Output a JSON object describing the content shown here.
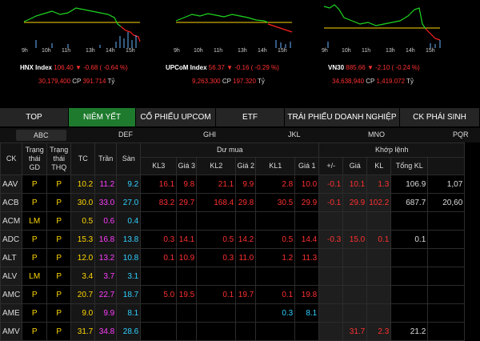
{
  "indices": [
    {
      "name": "HNX Index",
      "value": "106.40",
      "change": "▼ -0.68 ( -0.64 %)",
      "volume": "30,179,400",
      "cp_label": "CP",
      "amount": "391.714",
      "unit": "Tỷ"
    },
    {
      "name": "UPCoM Index",
      "value": "56.37",
      "change": "▼ -0.16 ( -0.29 %)",
      "volume": "9,263,300",
      "cp_label": "CP",
      "amount": "197.320",
      "unit": "Tỷ"
    },
    {
      "name": "VN30",
      "value": "885.66",
      "change": "▼ -2.10 ( -0.24 %)",
      "volume": "34,638,940",
      "cp_label": "CP",
      "amount": "1,419.072",
      "unit": "Tỷ"
    }
  ],
  "chart_ticks": [
    "9h",
    "10h",
    "11h",
    "13h",
    "14h",
    "15h"
  ],
  "tabs": [
    "TOP",
    "NIÊM YẾT",
    "CỔ PHIẾU UPCOM",
    "ETF",
    "TRÁI PHIẾU DOANH NGHIỆP",
    "CK PHÁI SINH"
  ],
  "letters": [
    "ABC",
    "DEF",
    "GHI",
    "JKL",
    "MNO",
    "PQR"
  ],
  "headers": {
    "ck": "CK",
    "status_gd": "Trạng thái GD",
    "status_thq": "Trạng thái THQ",
    "tc": "TC",
    "tran": "Trần",
    "san": "Sàn",
    "du_mua": "Dư mua",
    "khop_lenh": "Khớp lệnh",
    "kl3": "KL3",
    "gia3": "Giá 3",
    "kl2": "KL2",
    "gia2": "Giá 2",
    "kl1": "KL1",
    "gia1": "Giá 1",
    "pm": "+/-",
    "gia": "Giá",
    "kl": "KL",
    "tong_kl": "Tổng KL"
  },
  "rows": [
    {
      "ck": "AAV",
      "gd": "P",
      "thq": "P",
      "tc": "10.2",
      "tran": "11.2",
      "san": "9.2",
      "kl3": "16.1",
      "g3": "9.8",
      "kl2": "21.1",
      "g2": "9.9",
      "kl1": "2.8",
      "g1": "10.0",
      "pm": "-0.1",
      "gia": "10.1",
      "kl": "1.3",
      "tong": "106.9",
      "extra": "1,07"
    },
    {
      "ck": "ACB",
      "gd": "P",
      "thq": "P",
      "tc": "30.0",
      "tran": "33.0",
      "san": "27.0",
      "kl3": "83.2",
      "g3": "29.7",
      "kl2": "168.4",
      "g2": "29.8",
      "kl1": "30.5",
      "g1": "29.9",
      "pm": "-0.1",
      "gia": "29.9",
      "kl": "102.2",
      "tong": "687.7",
      "extra": "20,60"
    },
    {
      "ck": "ACM",
      "gd": "LM",
      "thq": "P",
      "tc": "0.5",
      "tran": "0.6",
      "san": "0.4",
      "kl3": "",
      "g3": "",
      "kl2": "",
      "g2": "",
      "kl1": "",
      "g1": "",
      "pm": "",
      "gia": "",
      "kl": "",
      "tong": "",
      "extra": ""
    },
    {
      "ck": "ADC",
      "gd": "P",
      "thq": "P",
      "tc": "15.3",
      "tran": "16.8",
      "san": "13.8",
      "kl3": "0.3",
      "g3": "14.1",
      "kl2": "0.5",
      "g2": "14.2",
      "kl1": "0.5",
      "g1": "14.4",
      "pm": "-0.3",
      "gia": "15.0",
      "kl": "0.1",
      "tong": "0.1",
      "extra": ""
    },
    {
      "ck": "ALT",
      "gd": "P",
      "thq": "P",
      "tc": "12.0",
      "tran": "13.2",
      "san": "10.8",
      "kl3": "0.1",
      "g3": "10.9",
      "kl2": "0.3",
      "g2": "11.0",
      "kl1": "1.2",
      "g1": "11.3",
      "pm": "",
      "gia": "",
      "kl": "",
      "tong": "",
      "extra": ""
    },
    {
      "ck": "ALV",
      "gd": "LM",
      "thq": "P",
      "tc": "3.4",
      "tran": "3.7",
      "san": "3.1",
      "kl3": "",
      "g3": "",
      "kl2": "",
      "g2": "",
      "kl1": "",
      "g1": "",
      "pm": "",
      "gia": "",
      "kl": "",
      "tong": "",
      "extra": ""
    },
    {
      "ck": "AMC",
      "gd": "P",
      "thq": "P",
      "tc": "20.7",
      "tran": "22.7",
      "san": "18.7",
      "kl3": "5.0",
      "g3": "19.5",
      "kl2": "0.1",
      "g2": "19.7",
      "kl1": "0.1",
      "g1": "19.8",
      "pm": "",
      "gia": "",
      "kl": "",
      "tong": "",
      "extra": ""
    },
    {
      "ck": "AME",
      "gd": "P",
      "thq": "P",
      "tc": "9.0",
      "tran": "9.9",
      "san": "8.1",
      "kl3": "",
      "g3": "",
      "kl2": "",
      "g2": "",
      "kl1": "0.3",
      "g1": "8.1",
      "pm": "",
      "gia": "",
      "kl": "",
      "tong": "",
      "extra": ""
    },
    {
      "ck": "AMV",
      "gd": "P",
      "thq": "P",
      "tc": "31.7",
      "tran": "34.8",
      "san": "28.6",
      "kl3": "",
      "g3": "",
      "kl2": "",
      "g2": "",
      "kl1": "",
      "g1": "",
      "pm": "",
      "gia": "31.7",
      "kl": "2.3",
      "tong": "21.2",
      "extra": ""
    }
  ]
}
